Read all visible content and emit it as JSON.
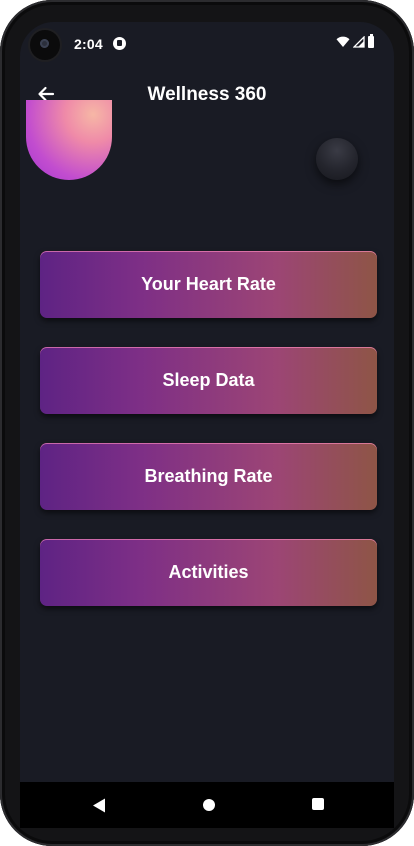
{
  "status_bar": {
    "time": "2:04",
    "icons": [
      "camera-cutout",
      "app-notification-icon",
      "wifi-icon",
      "signal-icon",
      "battery-icon"
    ]
  },
  "app_bar": {
    "title": "Wellness 360",
    "back_icon": "arrow-left-icon"
  },
  "menu": {
    "items": [
      {
        "label": "Your Heart Rate"
      },
      {
        "label": "Sleep Data"
      },
      {
        "label": "Breathing Rate"
      },
      {
        "label": "Activities"
      }
    ]
  },
  "colors": {
    "background": "#191b24",
    "button_gradient_start": "#5e2384",
    "button_gradient_end": "#8e5546",
    "text": "#ffffff"
  },
  "nav_bar": {
    "icons": [
      "back-triangle-icon",
      "home-circle-icon",
      "recents-square-icon"
    ]
  }
}
